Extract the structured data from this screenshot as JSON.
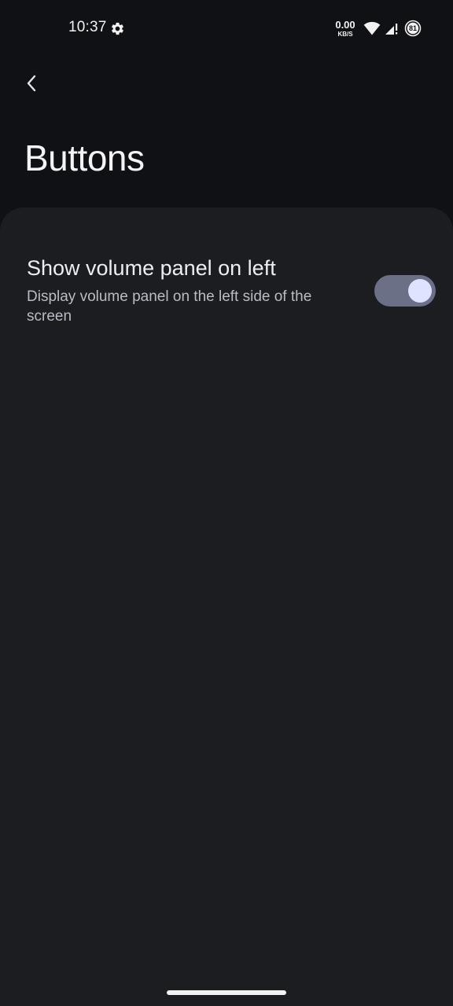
{
  "status_bar": {
    "time": "10:37",
    "net_speed_value": "0.00",
    "net_speed_unit": "KB/S",
    "battery_level": "81",
    "icons": [
      "gear-icon",
      "wifi-icon",
      "signal-icon",
      "battery-icon"
    ]
  },
  "header": {
    "back_icon": "chevron-left-icon",
    "title": "Buttons"
  },
  "settings": [
    {
      "title": "Show volume panel on left",
      "description": "Display volume panel on the left side of the screen",
      "toggle_on": true
    }
  ],
  "colors": {
    "background": "#101114",
    "panel": "#1c1d21",
    "toggle_track": "#6b7087",
    "toggle_thumb": "#dfe3ff"
  }
}
